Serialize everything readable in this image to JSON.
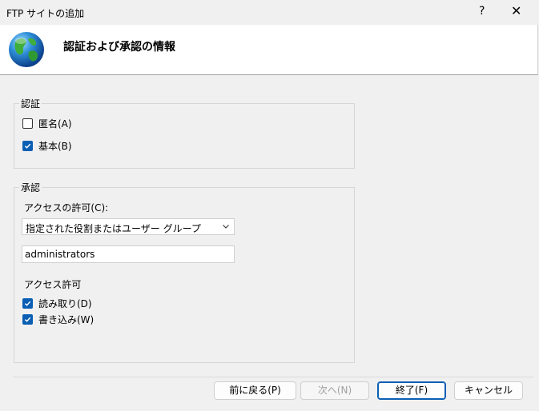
{
  "window": {
    "title": "FTP サイトの追加",
    "help_label": "?",
    "close_label": "✕"
  },
  "header": {
    "heading": "認証および承認の情報"
  },
  "authentication": {
    "legend": "認証",
    "anonymous": {
      "label": "匿名(A)",
      "checked": false
    },
    "basic": {
      "label": "基本(B)",
      "checked": true
    }
  },
  "authorization": {
    "legend": "承認",
    "access_label": "アクセスの許可(C):",
    "access_select_value": "指定された役割またはユーザー グループ",
    "users_value": "administrators",
    "permissions_label": "アクセス許可",
    "read": {
      "label": "読み取り(D)",
      "checked": true
    },
    "write": {
      "label": "書き込み(W)",
      "checked": true
    }
  },
  "buttons": {
    "previous": "前に戻る(P)",
    "next": "次へ(N)",
    "finish": "終了(F)",
    "cancel": "キャンセル"
  },
  "colors": {
    "accent": "#0a5fb4",
    "background": "#f0f0f0"
  }
}
